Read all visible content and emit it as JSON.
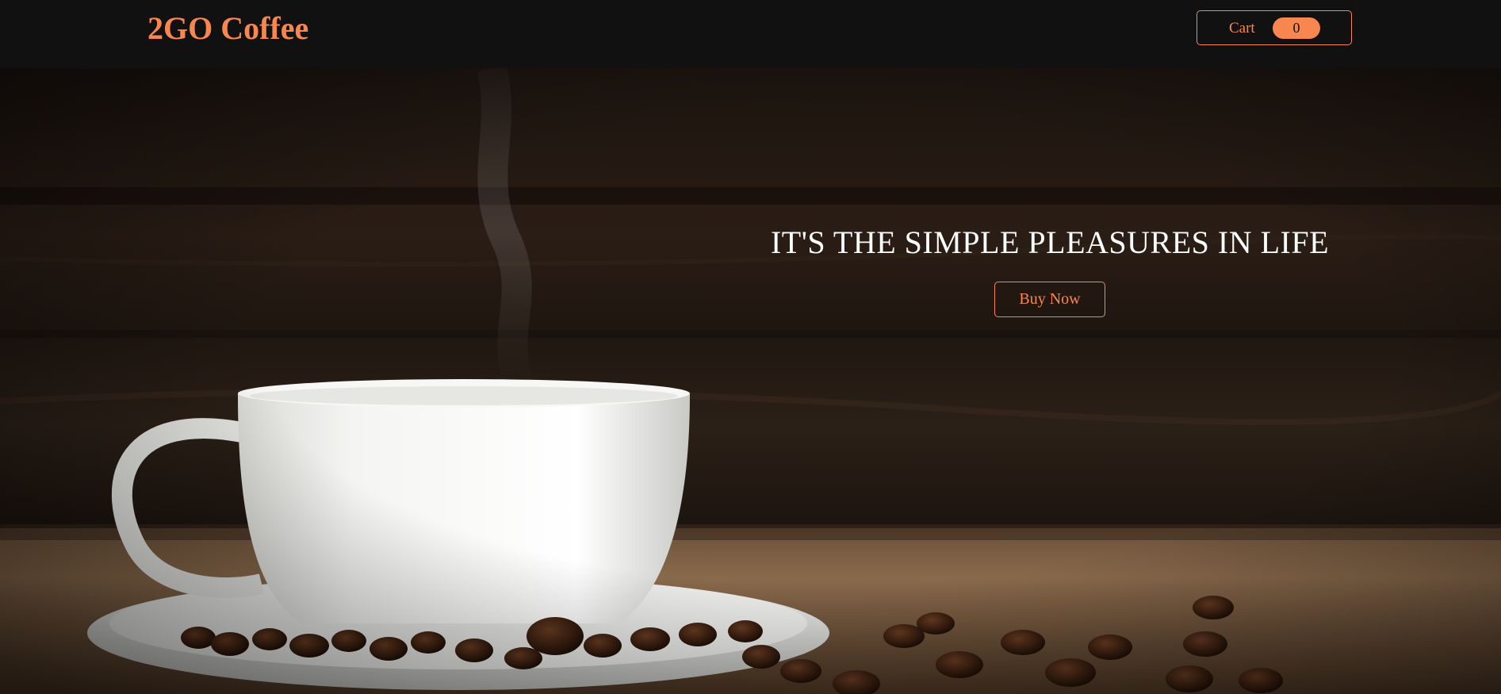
{
  "navbar": {
    "brand": "2GO Coffee",
    "cart_label": "Cart",
    "cart_count": "0"
  },
  "hero": {
    "headline": "IT'S THE SIMPLE PLEASURES IN LIFE",
    "buy_button": "Buy Now",
    "image": "coffee-cup-on-saucer-with-beans-photo"
  },
  "colors": {
    "accent": "#f7874f",
    "navbar_bg": "#111111",
    "headline": "#ffffff"
  }
}
